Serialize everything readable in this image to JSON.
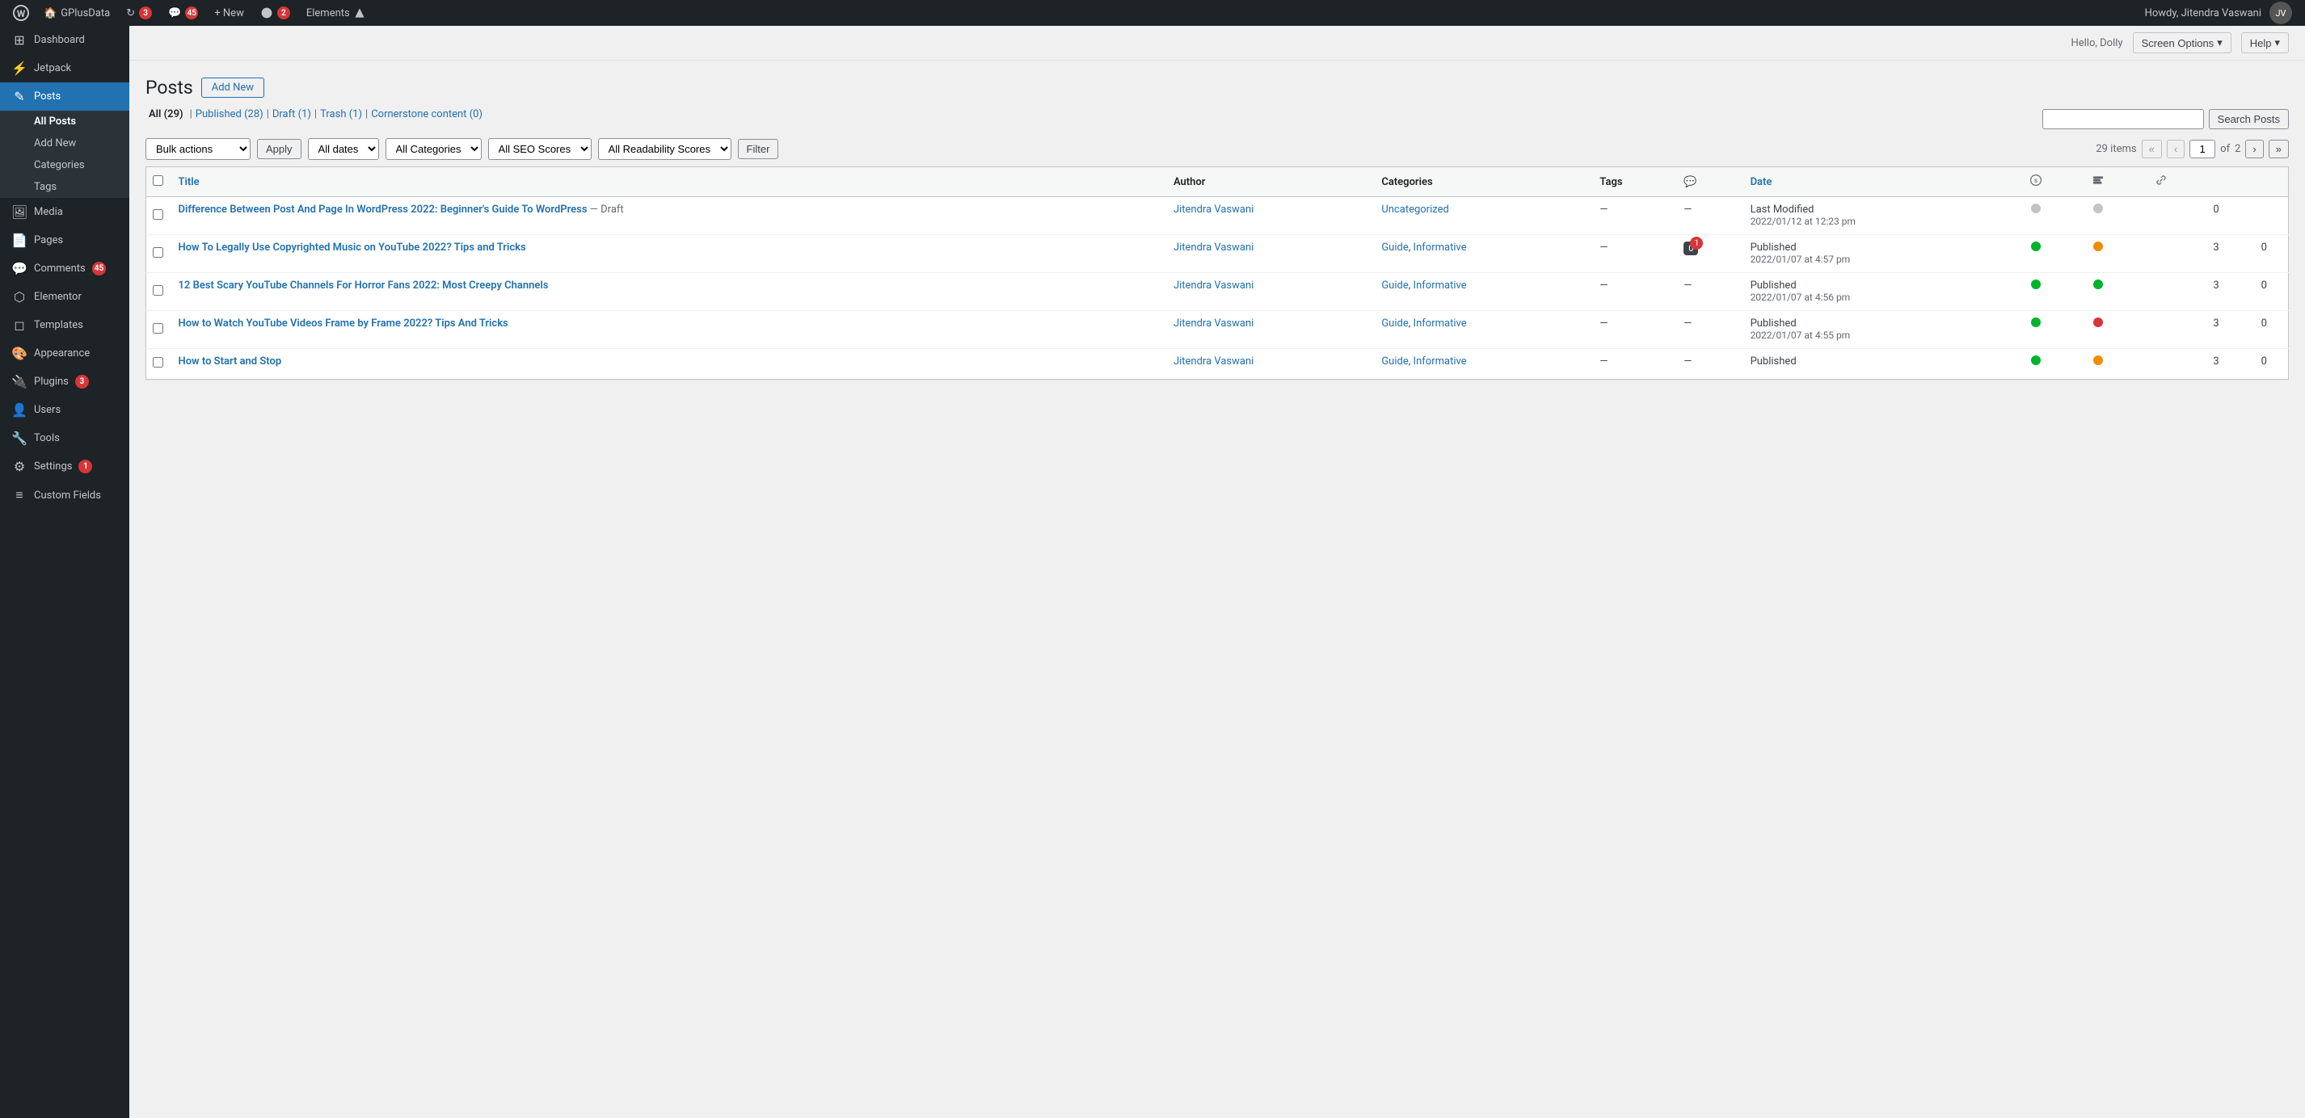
{
  "adminbar": {
    "logo": "W",
    "items": [
      {
        "id": "site-name",
        "label": "GPlusData",
        "icon": "🏠"
      },
      {
        "id": "updates",
        "label": "3",
        "icon": "↻",
        "badge": "3"
      },
      {
        "id": "comments",
        "label": "45",
        "icon": "💬",
        "badge": "45"
      },
      {
        "id": "new",
        "label": "+ New",
        "icon": ""
      },
      {
        "id": "yoast",
        "label": "2",
        "badge": "2"
      },
      {
        "id": "elements",
        "label": "Elements",
        "icon": ""
      }
    ],
    "right": {
      "howdy": "Howdy, Jitendra Vaswani",
      "avatar_initials": "JV"
    }
  },
  "sidebar": {
    "items": [
      {
        "id": "dashboard",
        "label": "Dashboard",
        "icon": "⊞"
      },
      {
        "id": "jetpack",
        "label": "Jetpack",
        "icon": "⚡"
      },
      {
        "id": "posts",
        "label": "Posts",
        "icon": "✎",
        "active": true
      },
      {
        "id": "media",
        "label": "Media",
        "icon": "🖼"
      },
      {
        "id": "pages",
        "label": "Pages",
        "icon": "📄"
      },
      {
        "id": "comments",
        "label": "Comments",
        "icon": "💬",
        "badge": "45"
      },
      {
        "id": "elementor",
        "label": "Elementor",
        "icon": "⬡"
      },
      {
        "id": "templates",
        "label": "Templates",
        "icon": "◻"
      },
      {
        "id": "appearance",
        "label": "Appearance",
        "icon": "🎨"
      },
      {
        "id": "plugins",
        "label": "Plugins",
        "icon": "🔌",
        "badge": "3"
      },
      {
        "id": "users",
        "label": "Users",
        "icon": "👤"
      },
      {
        "id": "tools",
        "label": "Tools",
        "icon": "🔧"
      },
      {
        "id": "settings",
        "label": "Settings",
        "icon": "⚙",
        "badge": "1"
      },
      {
        "id": "custom-fields",
        "label": "Custom Fields",
        "icon": "≡"
      }
    ],
    "submenu": {
      "posts": [
        {
          "id": "all-posts",
          "label": "All Posts",
          "active": true
        },
        {
          "id": "add-new",
          "label": "Add New"
        },
        {
          "id": "categories",
          "label": "Categories"
        },
        {
          "id": "tags",
          "label": "Tags"
        }
      ]
    }
  },
  "topbar": {
    "hello_dolly": "Hello, Dolly",
    "screen_options": "Screen Options",
    "help": "Help"
  },
  "page": {
    "title": "Posts",
    "add_new": "Add New",
    "filter_links": [
      {
        "id": "all",
        "label": "All",
        "count": "29",
        "active": true
      },
      {
        "id": "published",
        "label": "Published",
        "count": "28"
      },
      {
        "id": "draft",
        "label": "Draft",
        "count": "1"
      },
      {
        "id": "trash",
        "label": "Trash",
        "count": "1"
      },
      {
        "id": "cornerstone",
        "label": "Cornerstone content",
        "count": "0"
      }
    ],
    "search": {
      "placeholder": "",
      "button": "Search Posts"
    },
    "bulk_actions": "Bulk actions",
    "apply": "Apply",
    "filters": {
      "dates": {
        "label": "All dates",
        "options": [
          "All dates"
        ]
      },
      "categories": {
        "label": "All Categories",
        "options": [
          "All Categories"
        ]
      },
      "seo_scores": {
        "label": "All SEO Scores",
        "options": [
          "All SEO Scores"
        ]
      },
      "readability": {
        "label": "All Readability Scores",
        "options": [
          "All Readability Scores"
        ]
      }
    },
    "filter_btn": "Filter",
    "pagination": {
      "total_items": "29 items",
      "current_page": "1",
      "total_pages": "2"
    }
  },
  "table": {
    "columns": [
      {
        "id": "title",
        "label": "Title"
      },
      {
        "id": "author",
        "label": "Author"
      },
      {
        "id": "categories",
        "label": "Categories"
      },
      {
        "id": "tags",
        "label": "Tags"
      },
      {
        "id": "comments",
        "label": "💬"
      },
      {
        "id": "date",
        "label": "Date"
      },
      {
        "id": "seo",
        "label": "seo-icon"
      },
      {
        "id": "readability",
        "label": "readability-icon"
      },
      {
        "id": "link",
        "label": "link-icon"
      },
      {
        "id": "count1",
        "label": ""
      },
      {
        "id": "count2",
        "label": ""
      }
    ],
    "rows": [
      {
        "id": 1,
        "title": "Difference Between Post And Page In WordPress 2022: Beginner's Guide To WordPress",
        "title_suffix": "— Draft",
        "author": "Jitendra Vaswani",
        "categories": "Uncategorized",
        "categories_list": [
          "Uncategorized"
        ],
        "tags": "—",
        "comments": "—",
        "comment_count": null,
        "date_status": "Last Modified",
        "date": "2022/01/12 at 12:23 pm",
        "dot1_color": "gray",
        "dot2_color": "gray",
        "count1": "0",
        "count2": ""
      },
      {
        "id": 2,
        "title": "How To Legally Use Copyrighted Music on YouTube 2022? Tips and Tricks",
        "title_suffix": "",
        "author": "Jitendra Vaswani",
        "categories": "Guide, Informative",
        "categories_list": [
          "Guide",
          "Informative"
        ],
        "tags": "—",
        "comments_bubble": true,
        "comment_dark": "0",
        "comment_badge": "1",
        "date_status": "Published",
        "date": "2022/01/07 at 4:57 pm",
        "dot1_color": "green",
        "dot2_color": "orange",
        "count1": "3",
        "count2": "0"
      },
      {
        "id": 3,
        "title": "12 Best Scary YouTube Channels For Horror Fans 2022: Most Creepy Channels",
        "title_suffix": "",
        "author": "Jitendra Vaswani",
        "categories": "Guide, Informative",
        "categories_list": [
          "Guide",
          "Informative"
        ],
        "tags": "—",
        "comments": "—",
        "date_status": "Published",
        "date": "2022/01/07 at 4:56 pm",
        "dot1_color": "green",
        "dot2_color": "green",
        "count1": "3",
        "count2": "0"
      },
      {
        "id": 4,
        "title": "How to Watch YouTube Videos Frame by Frame 2022? Tips And Tricks",
        "title_suffix": "",
        "author": "Jitendra Vaswani",
        "categories": "Guide, Informative",
        "categories_list": [
          "Guide",
          "Informative"
        ],
        "tags": "—",
        "comments": "—",
        "date_status": "Published",
        "date": "2022/01/07 at 4:55 pm",
        "dot1_color": "green",
        "dot2_color": "red",
        "count1": "3",
        "count2": "0"
      },
      {
        "id": 5,
        "title": "How to Start and Stop",
        "title_suffix": "",
        "author": "Jitendra Vaswani",
        "categories": "Guide, Informative",
        "categories_list": [
          "Guide",
          "Informative"
        ],
        "tags": "—",
        "comments": "—",
        "date_status": "Published",
        "date": "",
        "dot1_color": "green",
        "dot2_color": "orange",
        "count1": "3",
        "count2": "0"
      }
    ]
  }
}
